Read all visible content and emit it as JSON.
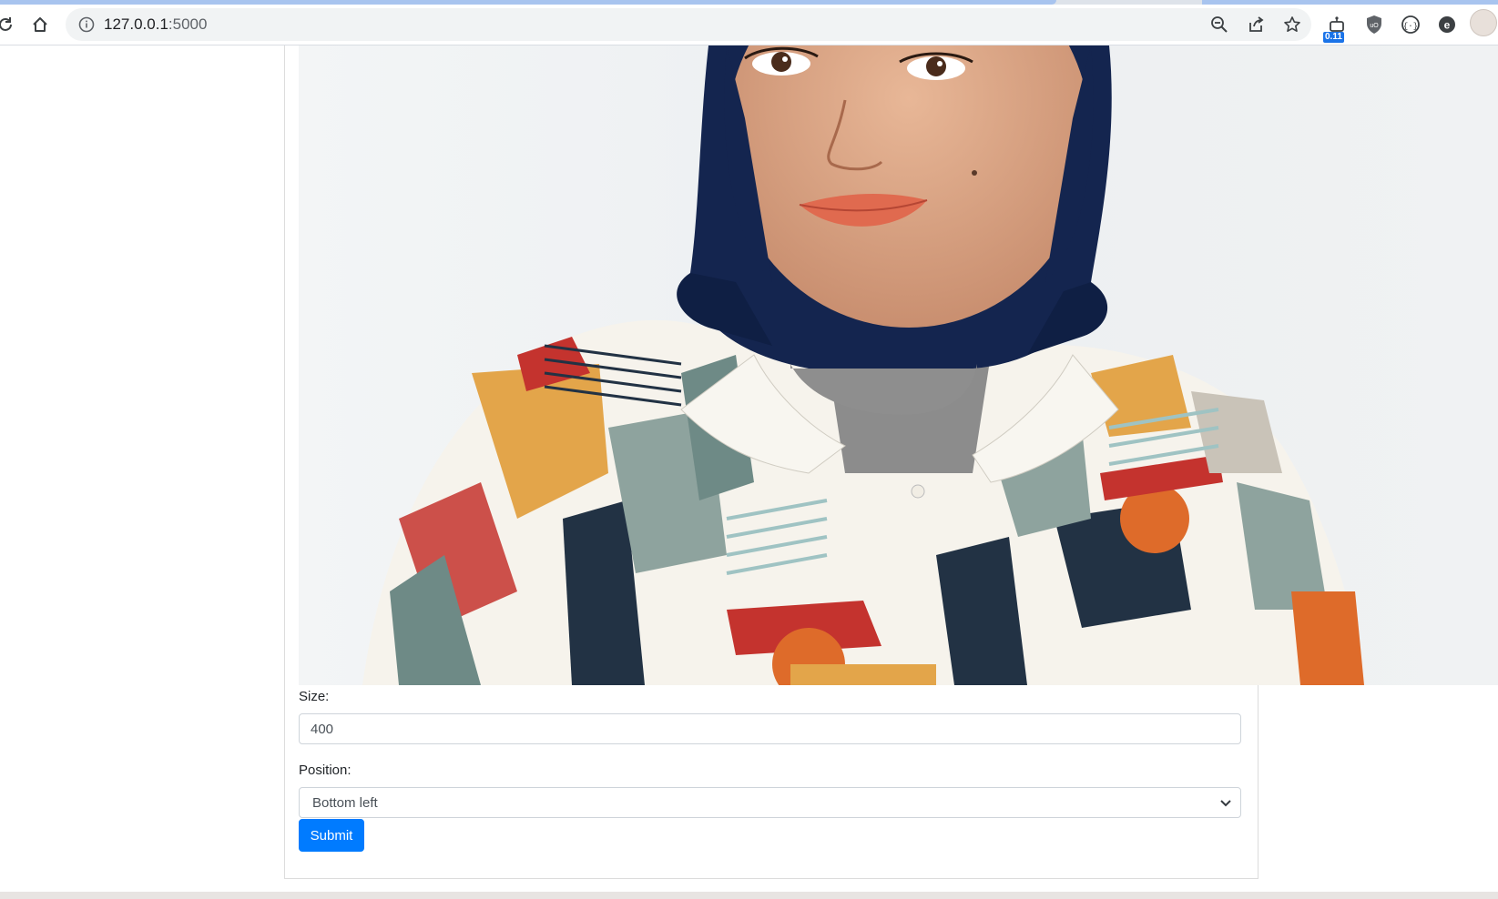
{
  "browser": {
    "url_host": "127.0.0.1",
    "url_port": ":5000",
    "extension_badge": "0.11"
  },
  "form": {
    "size_label": "Size:",
    "size_value": "400",
    "position_label": "Position:",
    "position_value": "Bottom left",
    "submit_label": "Submit"
  }
}
